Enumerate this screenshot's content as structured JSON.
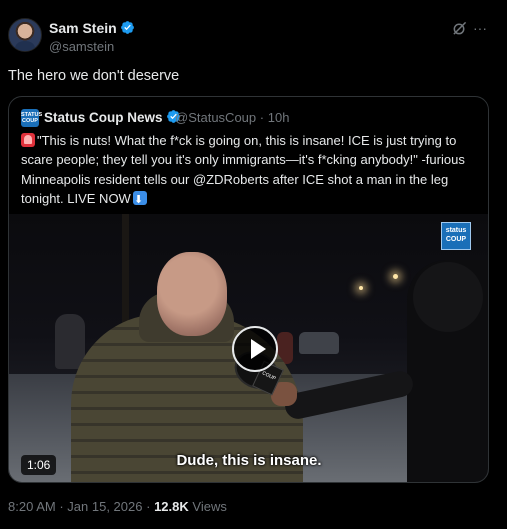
{
  "author": {
    "name": "Sam Stein",
    "handle": "@samstein",
    "avatar_icon": "avatar-photo"
  },
  "post_text": "The hero we don't deserve",
  "quote": {
    "name": "Status Coup News",
    "handle": "@StatusCoup",
    "separator": "·",
    "time": "10h",
    "text": "\"This is nuts! What the f*ck is going on, this is insane! ICE is just trying to scare people; they tell you it's only immigrants—it's f*cking anybody!\" -furious Minneapolis resident tells our @ZDRoberts after ICE shot a man in the leg tonight. LIVE NOW",
    "logo_text": "STATUS COUP",
    "video": {
      "duration": "1:06",
      "caption": "Dude, this is insane.",
      "badge_text": "status COUP",
      "mic_flag_text": "COUP"
    }
  },
  "footer": {
    "time": "8:20 AM",
    "dot1": "·",
    "date": "Jan 15, 2026",
    "dot2": "·",
    "views_count": "12.8K",
    "views_label": "Views"
  },
  "colors": {
    "background": "#000000",
    "text": "#e7e9ea",
    "muted": "#71767b",
    "verified": "#1d9bf0",
    "border": "#2f3336"
  },
  "icons": [
    "verified-badge-icon",
    "grok-icon",
    "more-icon",
    "alert-emoji",
    "down-arrow-emoji",
    "play-icon"
  ]
}
